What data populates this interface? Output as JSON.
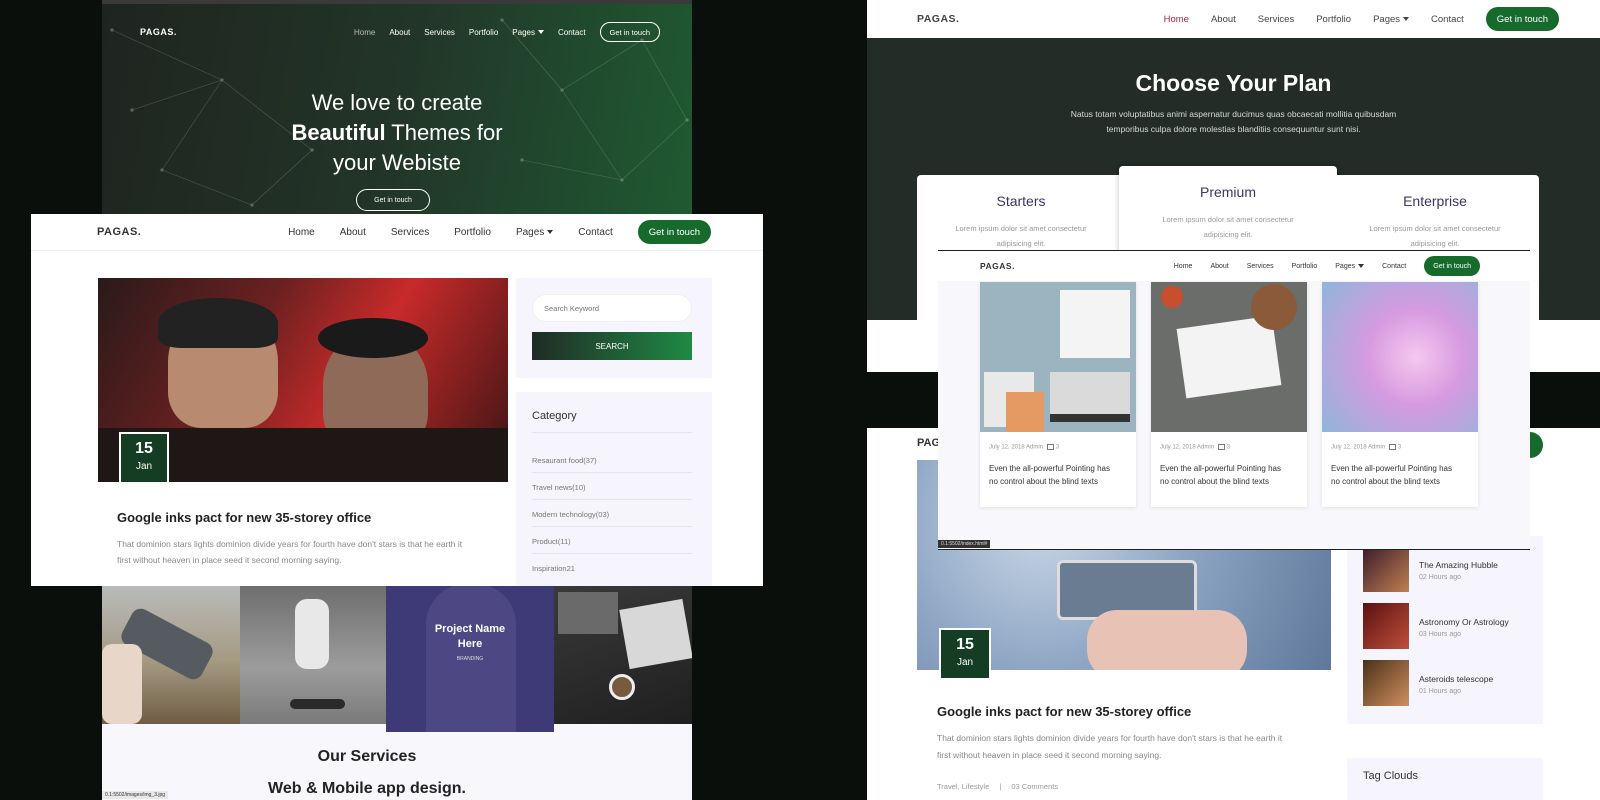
{
  "nav": {
    "brand": "PAGAS.",
    "home": "Home",
    "about": "About",
    "services": "Services",
    "portfolio": "Portfolio",
    "pages": "Pages",
    "contact": "Contact",
    "cta": "Get in touch"
  },
  "hero": {
    "line1": "We love to create",
    "bold": "Beautiful",
    "line2_rest": " Themes for",
    "line3": "your Webiste",
    "button": "Get in touch"
  },
  "blog": {
    "search_placeholder": "Search Keyword",
    "search_button": "SEARCH",
    "date_day": "15",
    "date_month": "Jan",
    "post_title": "Google inks pact for new 35-storey office",
    "post_excerpt_1": "That dominion stars lights dominion divide years for fourth have don't stars is that he earth it",
    "post_excerpt_2": "first without heaven in place seed it second morning saying.",
    "category_title": "Category",
    "categories": [
      "Resaurant food(37)",
      "Travel news(10)",
      "Modern technology(03)",
      "Product(11)",
      "Inspiration21"
    ],
    "post_tags": "Travel, Lifestyle",
    "post_separator": "|",
    "post_comments": "03 Comments"
  },
  "portfolio": {
    "project_name_1": "Project Name",
    "project_name_2": "Here",
    "project_category": "BRANDING",
    "services_title": "Our Services",
    "service_1": "Web & Mobile app design."
  },
  "pricing": {
    "title": "Choose Your Plan",
    "subtitle_1": "Natus totam voluptatibus animi aspernatur ducimus quas obcaecati mollitia quibusdam",
    "subtitle_2": "temporibus culpa dolore molestias blanditiis consequuntur sunt nisi.",
    "plans": [
      {
        "name": "Starters",
        "desc_1": "Lorem ipsum dolor sit amet consectetur",
        "desc_2": "adipisicing elit."
      },
      {
        "name": "Premium",
        "desc_1": "Lorem ipsum dolor sit amet consectetur",
        "desc_2": "adipisicing elit."
      },
      {
        "name": "Enterprise",
        "desc_1": "Lorem ipsum dolor sit amet consectetur",
        "desc_2": "adipisicing elit."
      }
    ]
  },
  "news": {
    "meta_date": "July 12, 2018",
    "meta_author": "Admin",
    "meta_comments": "3",
    "card_text_1": "Even the all-powerful Pointing has",
    "card_text_2": "no control about the blind texts",
    "status_url": "0.1:5502/index.html#"
  },
  "recent": {
    "items": [
      {
        "title": "The Amazing Hubble",
        "time": "02 Hours ago"
      },
      {
        "title": "Astronomy Or Astrology",
        "time": "03 Hours ago"
      },
      {
        "title": "Asteroids telescope",
        "time": "01 Hours ago"
      }
    ],
    "tag_clouds": "Tag Clouds"
  },
  "status_left": "0.1:5502/images/img_3.jpg",
  "colors": {
    "accent": "#166b2c",
    "dark": "#1f2b25",
    "sidebar": "#f6f4fc"
  }
}
